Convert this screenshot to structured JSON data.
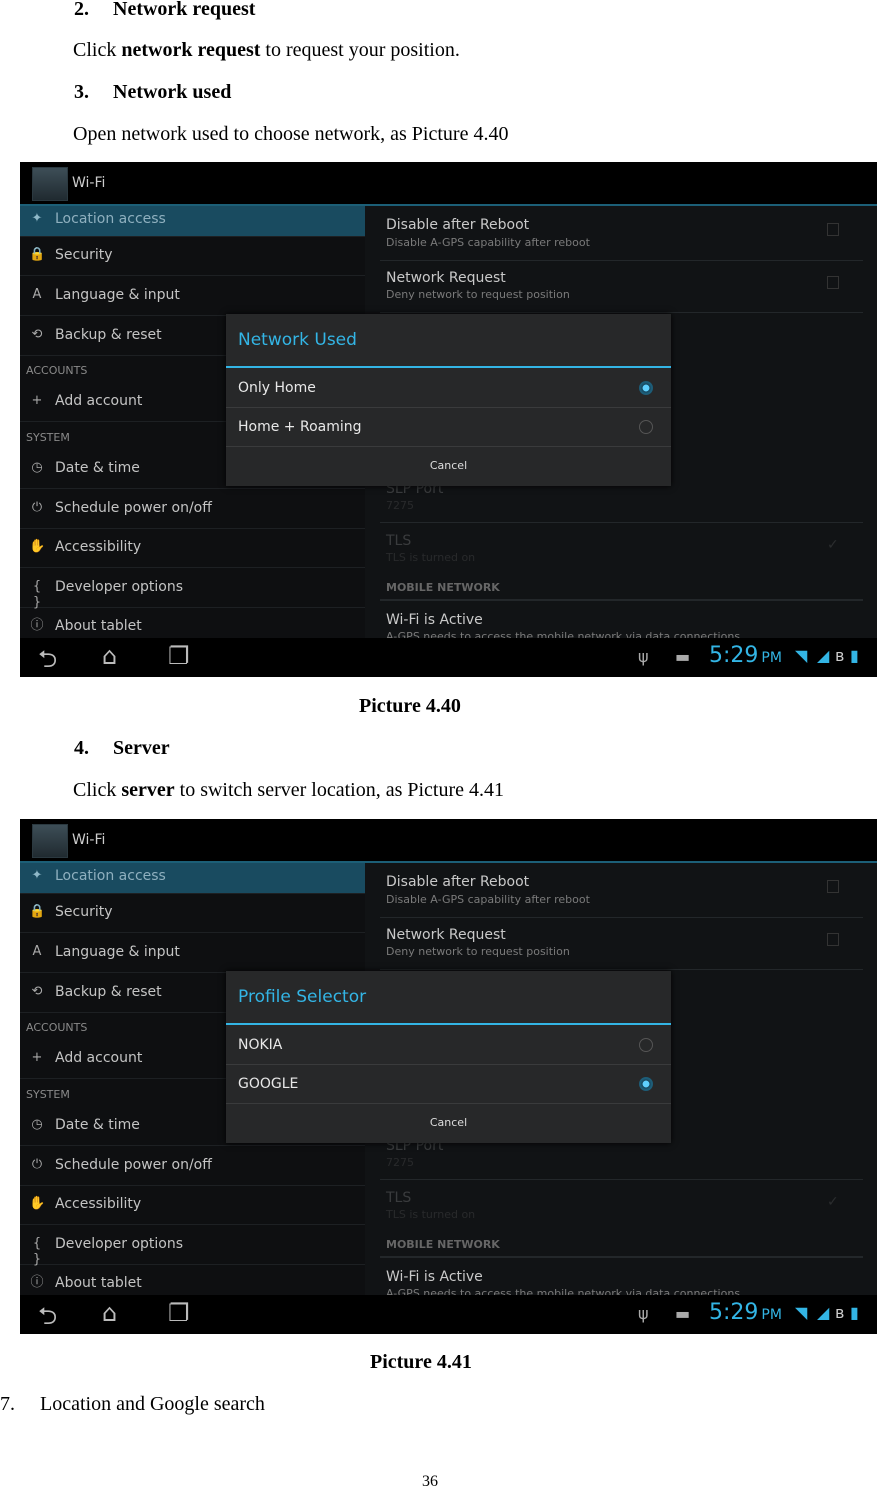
{
  "doc": {
    "s2_heading_num": "2.",
    "s2_heading": "Network request",
    "s2_text_pre": "Click ",
    "s2_text_bold": "network request",
    "s2_text_post": " to request your position.",
    "s3_heading_num": "3.",
    "s3_heading": "Network used",
    "s3_text": "Open network used to choose network, as Picture 4.40",
    "caption1": "Picture 4.40",
    "s4_heading_num": "4.",
    "s4_heading": "Server",
    "s4_text_pre": "Click ",
    "s4_text_bold": "server",
    "s4_text_post": " to switch server location, as Picture 4.41",
    "caption2": "Picture 4.41",
    "s7_num": "7.",
    "s7_text": "Location and Google search",
    "page_number": "36"
  },
  "screen": {
    "title": "Wi-Fi",
    "left_items": [
      {
        "label": "Location access",
        "icon": "location-icon",
        "glyph": "✦",
        "selected": true
      },
      {
        "label": "Security",
        "icon": "lock-icon",
        "glyph": "🔒"
      },
      {
        "label": "Language & input",
        "icon": "keyboard-a-icon",
        "glyph": "A"
      },
      {
        "label": "Backup & reset",
        "icon": "backup-icon",
        "glyph": "⟲"
      },
      {
        "header": "ACCOUNTS"
      },
      {
        "label": "Add account",
        "icon": "plus-icon",
        "glyph": "+"
      },
      {
        "header": "SYSTEM"
      },
      {
        "label": "Date & time",
        "icon": "clock-icon",
        "glyph": "◷"
      },
      {
        "label": "Schedule power on/off",
        "icon": "power-clock-icon",
        "glyph": "⏻"
      },
      {
        "label": "Accessibility",
        "icon": "hand-icon",
        "glyph": "✋"
      },
      {
        "label": "Developer options",
        "icon": "braces-icon",
        "glyph": "{ }"
      },
      {
        "label": "About tablet",
        "icon": "info-icon",
        "glyph": "ⓘ"
      }
    ],
    "right_items": [
      {
        "title": "Disable after Reboot",
        "subtitle": "Disable A-GPS capability after reboot",
        "checkbox": false
      },
      {
        "title": "Network Request",
        "subtitle": "Deny network to request position",
        "checkbox": false
      },
      {
        "title": "SLP Port",
        "subtitle": "7275",
        "faded": true
      },
      {
        "title": "TLS",
        "subtitle": "TLS is turned on",
        "faded": true,
        "checked": true
      },
      {
        "header": "MOBILE NETWORK"
      },
      {
        "title": "Wi-Fi is Active",
        "subtitle": "A-GPS needs to access the mobile network via data connections"
      }
    ],
    "time": "5:29",
    "ampm": "PM"
  },
  "dialogs": [
    {
      "title": "Network Used",
      "options": [
        {
          "label": "Only Home",
          "selected": true
        },
        {
          "label": "Home + Roaming",
          "selected": false
        }
      ],
      "cancel": "Cancel"
    },
    {
      "title": "Profile Selector",
      "options": [
        {
          "label": "NOKIA",
          "selected": false
        },
        {
          "label": "GOOGLE",
          "selected": true
        }
      ],
      "cancel": "Cancel"
    }
  ],
  "colors": {
    "accent": "#33b5e5",
    "selected_row": "#194b60"
  }
}
